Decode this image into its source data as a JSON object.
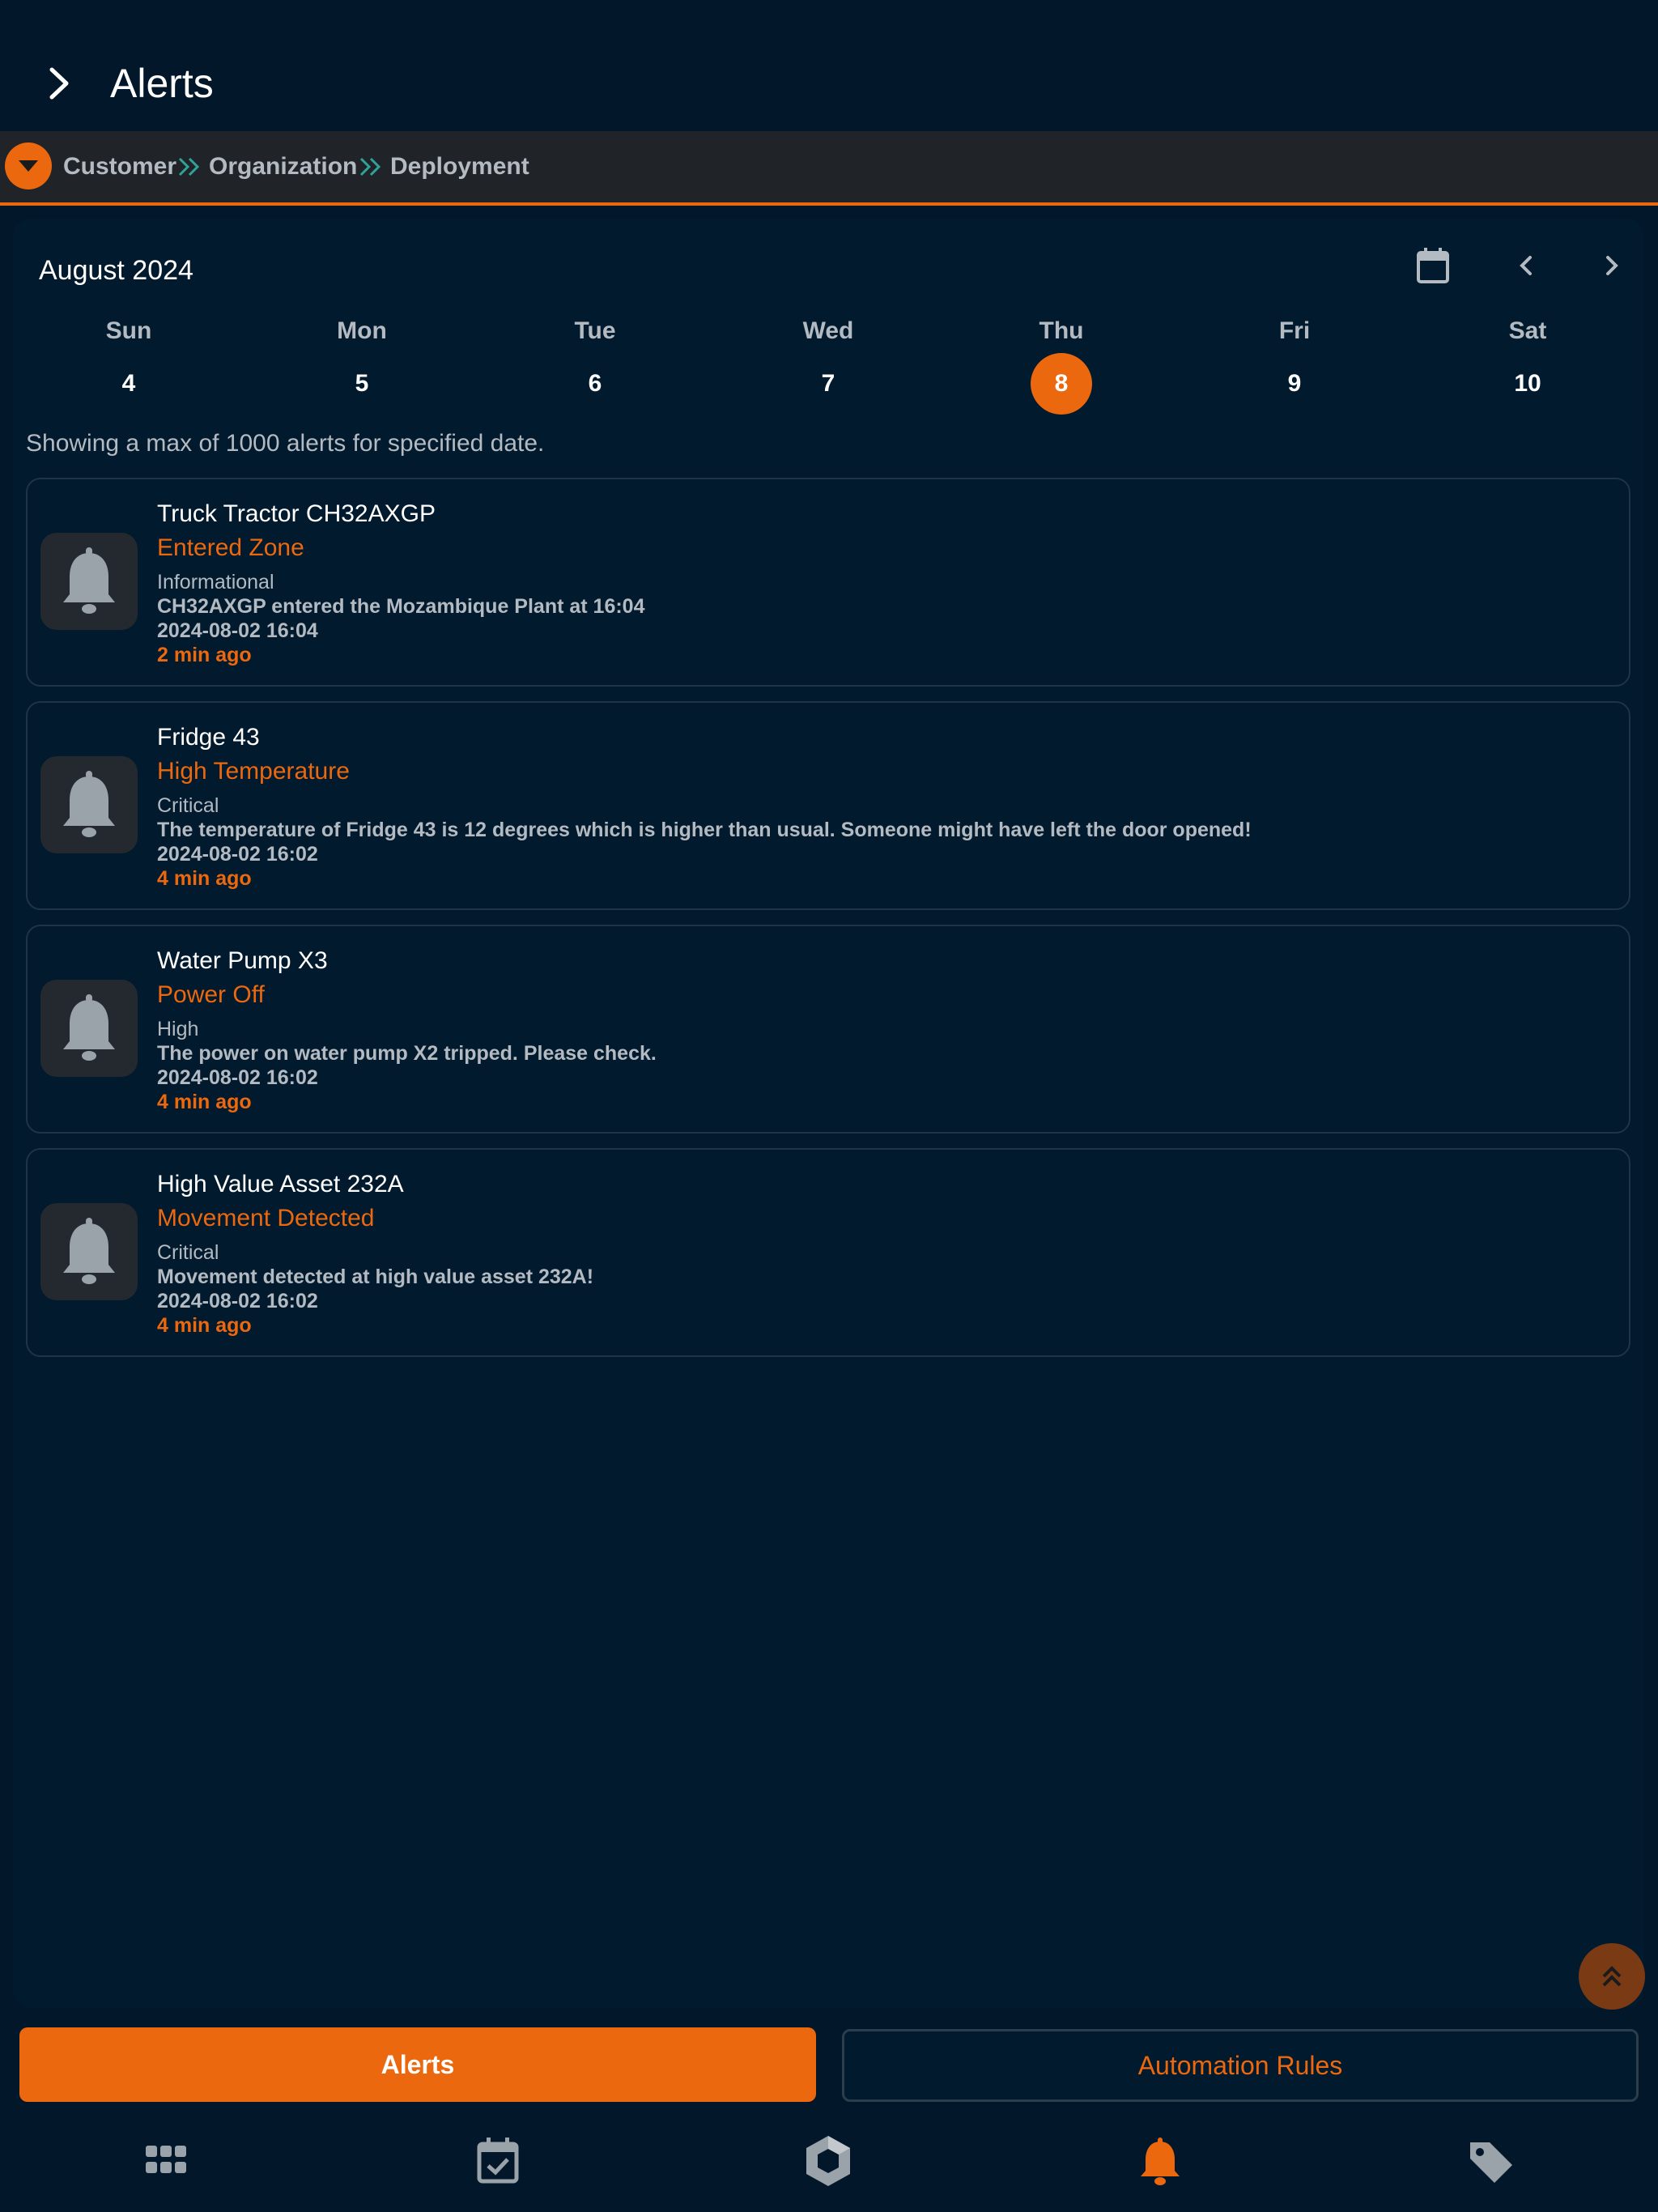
{
  "header": {
    "title": "Alerts"
  },
  "breadcrumb": {
    "items": [
      "Customer",
      "Organization",
      "Deployment"
    ]
  },
  "calendar": {
    "month_label": "August 2024",
    "days": [
      {
        "dow": "Sun",
        "num": "4"
      },
      {
        "dow": "Mon",
        "num": "5"
      },
      {
        "dow": "Tue",
        "num": "6"
      },
      {
        "dow": "Wed",
        "num": "7"
      },
      {
        "dow": "Thu",
        "num": "8",
        "selected": true
      },
      {
        "dow": "Fri",
        "num": "9"
      },
      {
        "dow": "Sat",
        "num": "10"
      }
    ]
  },
  "note": "Showing a max of 1000 alerts for specified date.",
  "alerts": [
    {
      "name": "Truck Tractor CH32AXGP",
      "type": "Entered Zone",
      "severity": "Informational",
      "message": "CH32AXGP entered the Mozambique Plant at 16:04",
      "timestamp": "2024-08-02 16:04",
      "ago": "2 min ago"
    },
    {
      "name": "Fridge 43",
      "type": "High Temperature",
      "severity": "Critical",
      "message": "The temperature of Fridge 43 is 12 degrees which is higher than usual. Someone might have left the door opened!",
      "timestamp": "2024-08-02 16:02",
      "ago": "4 min ago"
    },
    {
      "name": "Water Pump X3",
      "type": "Power Off",
      "severity": "High",
      "message": "The power on water pump X2 tripped. Please check.",
      "timestamp": "2024-08-02 16:02",
      "ago": "4 min ago"
    },
    {
      "name": "High Value Asset 232A",
      "type": "Movement Detected",
      "severity": "Critical",
      "message": "Movement detected at high value asset 232A!",
      "timestamp": "2024-08-02 16:02",
      "ago": "4 min ago"
    }
  ],
  "tabs": {
    "alerts_label": "Alerts",
    "rules_label": "Automation Rules"
  },
  "nav": {
    "icons": [
      "apps-grid-icon",
      "calendar-check-icon",
      "hexagon-logo-icon",
      "bell-icon",
      "tag-icon"
    ]
  },
  "colors": {
    "accent": "#eb680f",
    "background": "#02182a",
    "muted_text": "#b4bac1"
  }
}
